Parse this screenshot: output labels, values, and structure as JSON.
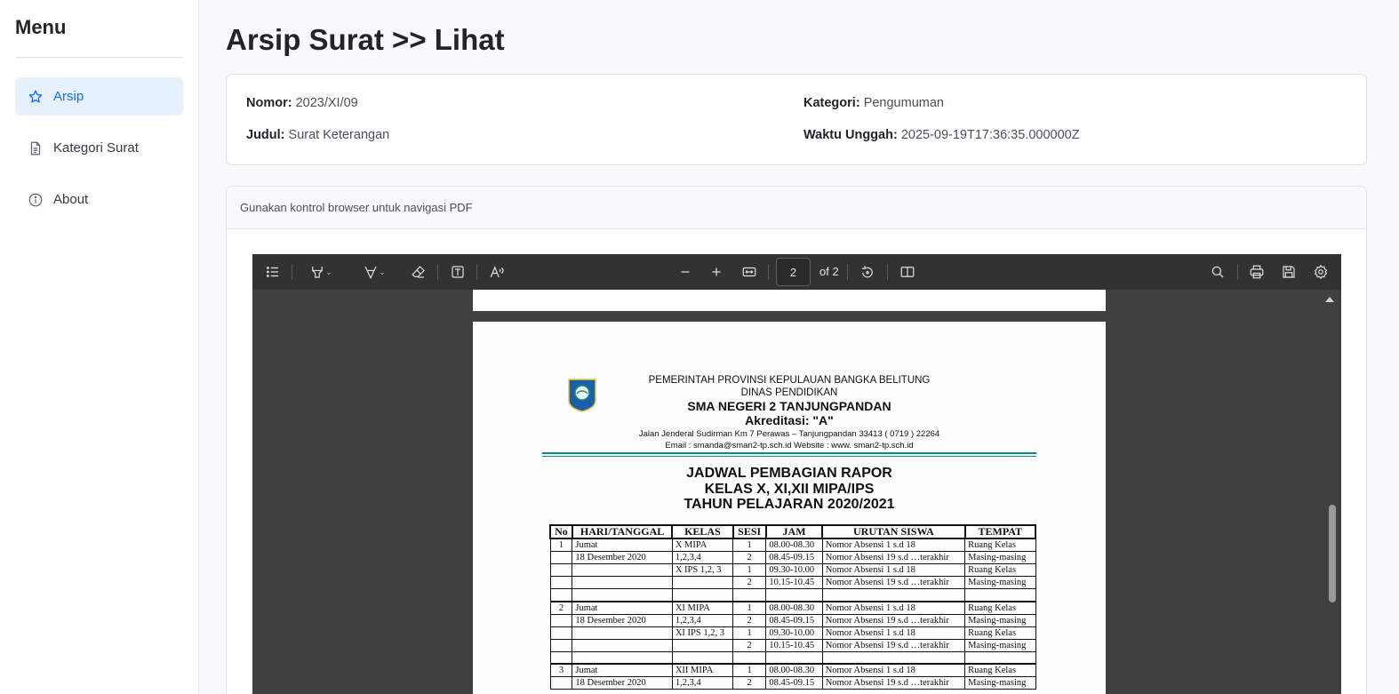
{
  "sidebar": {
    "title": "Menu",
    "items": [
      {
        "label": "Arsip",
        "icon": "star-icon",
        "active": true
      },
      {
        "label": "Kategori Surat",
        "icon": "document-icon",
        "active": false
      },
      {
        "label": "About",
        "icon": "info-icon",
        "active": false
      }
    ]
  },
  "page": {
    "title": "Arsip Surat >> Lihat"
  },
  "info": {
    "nomor_label": "Nomor:",
    "nomor_value": "2023/XI/09",
    "judul_label": "Judul:",
    "judul_value": "Surat Keterangan",
    "kategori_label": "Kategori:",
    "kategori_value": "Pengumuman",
    "waktu_label": "Waktu Unggah:",
    "waktu_value": "2025-09-19T17:36:35.000000Z"
  },
  "pdf_card": {
    "header_text": "Gunakan kontrol browser untuk navigasi PDF"
  },
  "viewer": {
    "current_page": "2",
    "page_of": "of 2",
    "toolbar_icons": [
      "outline-icon",
      "highlight-icon",
      "draw-icon",
      "erase-icon",
      "text-box-icon",
      "read-aloud-icon",
      "zoom-out-icon",
      "zoom-in-icon",
      "fit-page-icon",
      "rotate-icon",
      "page-view-icon",
      "search-icon",
      "print-icon",
      "save-icon",
      "settings-icon"
    ]
  },
  "document": {
    "header_line1": "PEMERINTAH PROVINSI KEPULAUAN BANGKA BELITUNG",
    "header_line2": "DINAS PENDIDIKAN",
    "header_line3": "SMA NEGERI 2 TANJUNGPANDAN",
    "header_line4": "Akreditasi: \"A\"",
    "header_line5": "Jalan Jenderal Sudirman Km 7 Perawas – Tanjungpandan 33413 ( 0719 )  22264",
    "header_line6": "Email : smanda@sman2-tp.sch.id  Website : www. sman2-tp.sch.id",
    "title1": "JADWAL PEMBAGIAN RAPOR",
    "title2": "KELAS X, XI,XII MIPA/IPS",
    "title3": "TAHUN PELAJARAN 2020/2021",
    "columns": [
      "No",
      "HARI/TANGGAL",
      "KELAS",
      "SESI",
      "JAM",
      "URUTAN SISWA",
      "TEMPAT"
    ],
    "rows": [
      [
        "1",
        "Jumat",
        "X  MIPA",
        "1",
        "08.00-08.30",
        "Nomor  Absensi 1 s.d 18",
        "Ruang Kelas"
      ],
      [
        "",
        "18 Desember 2020",
        "1,2,3,4",
        "2",
        "08.45-09.15",
        "Nomor  Absensi 19 s.d …terakhir",
        "Masing-masing"
      ],
      [
        "",
        "",
        "X IPS 1,2, 3",
        "1",
        "09.30-10.00",
        "Nomor  Absensi 1 s.d 18",
        "Ruang Kelas"
      ],
      [
        "",
        "",
        "",
        "2",
        "10.15-10.45",
        "Nomor  Absensi 19 s.d …terakhir",
        "Masing-masing"
      ],
      [
        "",
        "",
        "",
        "",
        "",
        "",
        ""
      ],
      [
        "2",
        "Jumat",
        "XI  MIPA",
        "1",
        "08.00-08.30",
        "Nomor  Absensi 1 s.d 18",
        "Ruang Kelas"
      ],
      [
        "",
        "18 Desember 2020",
        "1,2,3,4",
        "2",
        "08.45-09.15",
        "Nomor  Absensi 19 s.d …terakhir",
        "Masing-masing"
      ],
      [
        "",
        "",
        "XI IPS 1,2, 3",
        "1",
        "09.30-10.00",
        "Nomor  Absensi 1 s.d 18",
        "Ruang Kelas"
      ],
      [
        "",
        "",
        "",
        "2",
        "10.15-10.45",
        "Nomor  Absensi 19 s.d …terakhir",
        "Masing-masing"
      ],
      [
        "",
        "",
        "",
        "",
        "",
        "",
        ""
      ],
      [
        "3",
        "Jumat",
        "XII  MIPA",
        "1",
        "08.00-08.30",
        "Nomor  Absensi 1 s.d 18",
        "Ruang Kelas"
      ],
      [
        "",
        "18 Desember 2020",
        "1,2,3,4",
        "2",
        "08.45-09.15",
        "Nomor  Absensi 19 s.d …terakhir",
        "Masing-masing"
      ]
    ]
  },
  "colors": {
    "accent": "#0d6efd",
    "active_bg": "#e7f1fd",
    "viewer_bg": "#404040",
    "toolbar_bg": "#323232"
  }
}
